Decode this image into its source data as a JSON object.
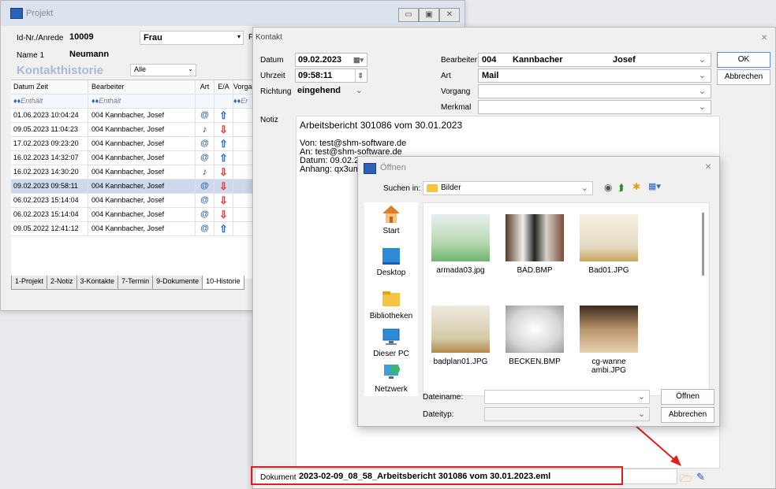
{
  "projekt": {
    "title": "Projekt",
    "id_label": "Id-Nr./Anrede",
    "id_value": "10009",
    "anrede": "Frau",
    "extra_letter": "F",
    "name_label": "Name 1",
    "name_value": "Neumann",
    "history_title": "Kontakthistorie",
    "filter_value": "Alle",
    "columns": [
      "Datum Zeit",
      "Bearbeiter",
      "Art",
      "E/A",
      "Vorga"
    ],
    "filter_row": [
      "Enthält",
      "Enthält",
      "",
      "",
      "Er"
    ],
    "rows": [
      {
        "datetime": "01.06.2023 10:04:24",
        "bearbeiter": "004 Kannbacher, Josef",
        "art": "mail",
        "ea": "up"
      },
      {
        "datetime": "09.05.2023 11:04:23",
        "bearbeiter": "004 Kannbacher, Josef",
        "art": "phone",
        "ea": "down"
      },
      {
        "datetime": "17.02.2023 09:23:20",
        "bearbeiter": "004 Kannbacher, Josef",
        "art": "mail",
        "ea": "up"
      },
      {
        "datetime": "16.02.2023 14:32:07",
        "bearbeiter": "004 Kannbacher, Josef",
        "art": "mail",
        "ea": "up"
      },
      {
        "datetime": "16.02.2023 14:30:20",
        "bearbeiter": "004 Kannbacher, Josef",
        "art": "phone",
        "ea": "down"
      },
      {
        "datetime": "09.02.2023 09:58:11",
        "bearbeiter": "004 Kannbacher, Josef",
        "art": "mail",
        "ea": "down"
      },
      {
        "datetime": "06.02.2023 15:14:04",
        "bearbeiter": "004 Kannbacher, Josef",
        "art": "mail",
        "ea": "down"
      },
      {
        "datetime": "06.02.2023 15:14:04",
        "bearbeiter": "004 Kannbacher, Josef",
        "art": "mail",
        "ea": "down"
      },
      {
        "datetime": "09.05.2022 12:41:12",
        "bearbeiter": "004 Kannbacher, Josef",
        "art": "mail",
        "ea": "up"
      }
    ],
    "tabs": [
      "1-Projekt",
      "2-Notiz",
      "3-Kontakte",
      "7-Termin",
      "9-Dokumente",
      "10-Historie"
    ]
  },
  "kontakt": {
    "title": "Kontakt",
    "datum_label": "Datum",
    "datum_value": "09.02.2023",
    "uhrzeit_label": "Uhrzeit",
    "uhrzeit_value": "09:58:11",
    "richtung_label": "Richtung",
    "richtung_value": "eingehend",
    "bearbeiter_label": "Bearbeiter",
    "bearbeiter_nr": "004",
    "bearbeiter_name": "Kannbacher",
    "bearbeiter_vorname": "Josef",
    "art_label": "Art",
    "art_value": "Mail",
    "vorgang_label": "Vorgang",
    "merkmal_label": "Merkmal",
    "ok_label": "OK",
    "abbrechen_label": "Abbrechen",
    "notiz_label": "Notiz",
    "notiz_lines": [
      "Arbeitsbericht 301086 vom 30.01.2023",
      "",
      "Von: test@shm-software.de",
      "An: test@shm-software.de",
      "Datum: 09.02.2",
      "Anhang: qx3um"
    ],
    "dokument_label": "Dokument",
    "dokument_value": "2023-02-09_08_58_Arbeitsbericht 301086 vom 30.01.2023.eml"
  },
  "oeffnen": {
    "title": "Öffnen",
    "suchen_in_label": "Suchen in:",
    "suchen_in_value": "Bilder",
    "places": [
      "Start",
      "Desktop",
      "Bibliotheken",
      "Dieser PC",
      "Netzwerk"
    ],
    "files": [
      "armada03.jpg",
      "BAD.BMP",
      "Bad01.JPG",
      "badplan01.JPG",
      "BECKEN.BMP",
      "cg-wanne ambi.JPG"
    ],
    "dateiname_label": "Dateiname:",
    "dateityp_label": "Dateityp:",
    "oeffnen_button": "Öffnen",
    "abbrechen_button": "Abbrechen"
  },
  "colors": {
    "accent": "#2b64c8",
    "highlight": "#e01e1e",
    "history_title": "#a9b9d4"
  }
}
